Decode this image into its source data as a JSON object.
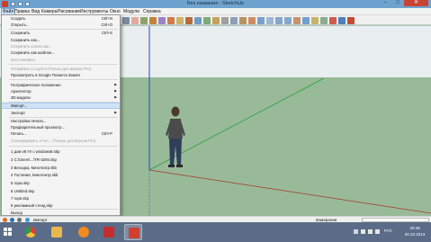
{
  "window": {
    "title": "Без названия - SketchUp",
    "minimize": "–",
    "maximize": "□",
    "close": "✕"
  },
  "menubar": {
    "items": [
      "Файл",
      "Правка",
      "Вид",
      "Камера",
      "Рисование",
      "Инструменты",
      "Окно",
      "Модули",
      "Справка"
    ],
    "active_index": 0
  },
  "file_menu": {
    "items": [
      {
        "label": "Создать",
        "shortcut": "Ctrl+N",
        "enabled": true
      },
      {
        "label": "Открыть...",
        "shortcut": "Ctrl+O",
        "enabled": true
      },
      {
        "label": "Сохранить",
        "shortcut": "Ctrl+S",
        "enabled": true
      },
      {
        "label": "Сохранить как...",
        "shortcut": "",
        "enabled": true
      },
      {
        "label": "Сохранить копию как...",
        "shortcut": "",
        "enabled": false
      },
      {
        "label": "Сохранить как шаблон...",
        "shortcut": "",
        "enabled": true
      },
      {
        "label": "Восстановить",
        "shortcut": "",
        "enabled": false
      },
      {
        "label": "Отправить в LayOut (Только для версии Pro)",
        "shortcut": "",
        "enabled": false
      },
      {
        "label": "Просмотреть в Google Планета Земля",
        "shortcut": "",
        "enabled": true
      },
      {
        "label": "Географическое положение",
        "shortcut": "",
        "enabled": true,
        "submenu": true
      },
      {
        "label": "Архитектор",
        "shortcut": "",
        "enabled": true,
        "submenu": true
      },
      {
        "label": "3D-модели",
        "shortcut": "",
        "enabled": true,
        "submenu": true
      },
      {
        "label": "Импорт...",
        "shortcut": "",
        "enabled": true,
        "highlighted": true
      },
      {
        "label": "Экспорт",
        "shortcut": "",
        "enabled": true,
        "submenu": true
      },
      {
        "label": "Настройка печати...",
        "shortcut": "",
        "enabled": true
      },
      {
        "label": "Предварительный просмотр...",
        "shortcut": "",
        "enabled": true
      },
      {
        "label": "Печать...",
        "shortcut": "Ctrl+P",
        "enabled": true
      },
      {
        "label": "Сгенерировать отчет... (Только для версии Pro)",
        "shortcut": "",
        "enabled": false
      },
      {
        "label": "1 дом v8 !!!! с windows8.skp",
        "shortcut": "",
        "enabled": true
      },
      {
        "label": "2 C:\\Users\\...\\TR-3294.skp",
        "shortcut": "",
        "enabled": true
      },
      {
        "label": "3 Беседка, Кинотеатр.skb",
        "shortcut": "",
        "enabled": true
      },
      {
        "label": "4 Гостиная, Кинотеатр.skb",
        "shortcut": "",
        "enabled": true
      },
      {
        "label": "5 горы.skp",
        "shortcut": "",
        "enabled": true
      },
      {
        "label": "6 Untitled.skp",
        "shortcut": "",
        "enabled": true
      },
      {
        "label": "7 горя.skp",
        "shortcut": "",
        "enabled": true
      },
      {
        "label": "8 рекламный стенд.skp",
        "shortcut": "",
        "enabled": true
      },
      {
        "label": "Выход",
        "shortcut": "",
        "enabled": true
      }
    ]
  },
  "statusbar": {
    "hint": "Импорт",
    "measurements_label": "Измерения",
    "measurements_value": ""
  },
  "taskbar": {
    "language": "РУС",
    "time": "20:48",
    "date": "20.10.2013"
  },
  "colors": {
    "titlebar": "#6fa3cf",
    "close_button": "#c74434",
    "sky": "#e9eef0",
    "ground": "#98ba98",
    "axis_red": "#a33a2a",
    "axis_green": "#2e9e3a",
    "axis_blue": "#2b45c4",
    "menu_highlight": "#cfe3f6",
    "taskbar": "#5b6c88"
  },
  "icons": {
    "app": "sketchup-icon",
    "start": "windows-logo-icon",
    "taskbar_apps": [
      "chrome-icon",
      "folder-icon",
      "media-player-icon",
      "pdf-icon",
      "sketchup-icon"
    ]
  }
}
